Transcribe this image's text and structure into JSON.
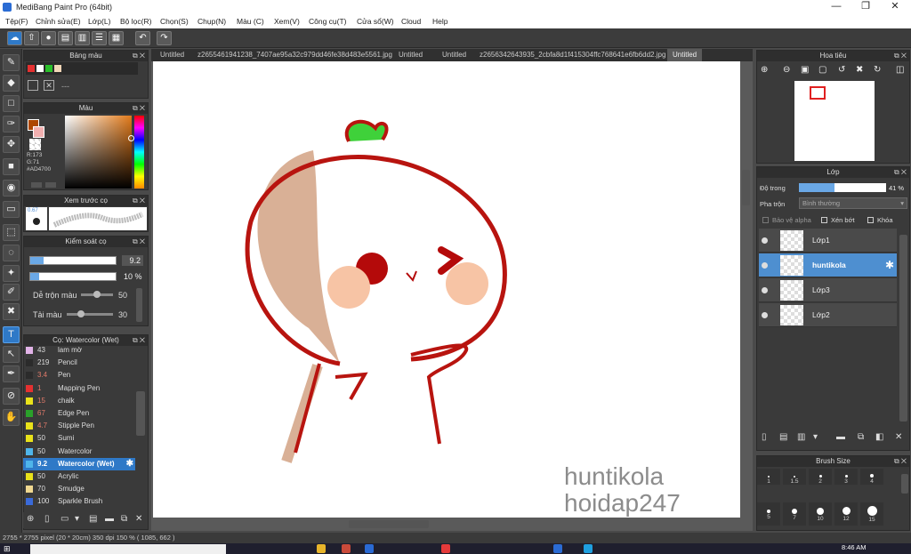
{
  "window": {
    "title": "MediBang Paint Pro (64bit)",
    "min": "—",
    "max": "❐",
    "close": "✕"
  },
  "menu": [
    "Tệp(F)",
    "Chỉnh sửa(E)",
    "Lớp(L)",
    "Bộ lọc(R)",
    "Chọn(S)",
    "Chụp(N)",
    "Màu (C)",
    "Xem(V)",
    "Công cụ(T)",
    "Cửa sổ(W)",
    "Cloud",
    "Help"
  ],
  "tabs": [
    "Untitled",
    "z2655461941238_7407ae95a32c979dd46fe38d483e5561.jpg",
    "Untitled",
    "Untitled",
    "z2656342643935_2cbfa8d1f415304ffc768641e6fb6dd2.jpg",
    "Untitled"
  ],
  "panels": {
    "palette": {
      "title": "Bảng màu",
      "sep": "---"
    },
    "color": {
      "title": "Màu",
      "r": "R:173",
      "g": "G:71",
      "hex": "#AD4700"
    },
    "preview": {
      "title": "Xem trước cọ",
      "size": "0.67"
    },
    "brushctl": {
      "title": "Kiểm soát cọ",
      "size_value": "9.2",
      "opacity_value": "10 %",
      "blend_label": "Dễ trộn màu",
      "blend_value": "50",
      "amount_label": "Tải màu",
      "amount_value": "30",
      "size_level": 0.16,
      "opacity_level": 0.1
    },
    "brushlist": {
      "title": "Cọ: Watercolor (Wet)",
      "items": [
        {
          "num": "43",
          "name": "lam mờ",
          "color": "#e2b3e8"
        },
        {
          "num": "219",
          "name": "Pencil",
          "color": "#2b2b2b"
        },
        {
          "num": "3.4",
          "name": "Pen",
          "color": "#2b2b2b"
        },
        {
          "num": "1",
          "name": "Mapping Pen",
          "color": "#e53030"
        },
        {
          "num": "15",
          "name": "chalk",
          "color": "#e9e21a"
        },
        {
          "num": "67",
          "name": "Edge Pen",
          "color": "#2aa12a"
        },
        {
          "num": "4.7",
          "name": "Stipple Pen",
          "color": "#e9e21a"
        },
        {
          "num": "50",
          "name": "Sumi",
          "color": "#e9e21a"
        },
        {
          "num": "50",
          "name": "Watercolor",
          "color": "#4fb5ea"
        },
        {
          "num": "9.2",
          "name": "Watercolor (Wet)",
          "color": "#4fb5ea"
        },
        {
          "num": "50",
          "name": "Acrylic",
          "color": "#e9e21a"
        },
        {
          "num": "70",
          "name": "Smudge",
          "color": "#f0d890"
        },
        {
          "num": "100",
          "name": "Sparkle Brush",
          "color": "#3a6ad9"
        }
      ]
    },
    "navigator": {
      "title": "Hoa tiêu"
    },
    "layers": {
      "title": "Lớp",
      "opacity_label": "Độ trong",
      "opacity_value": "41 %",
      "opacity_level": 0.41,
      "blend_label": "Pha trộn",
      "blend_value": "Bình thường",
      "protect_alpha": "Bảo vệ alpha",
      "clipping": "Xén bớt",
      "lock": "Khóa",
      "items": [
        "Lớp1",
        "huntikola",
        "Lớp3",
        "Lớp2"
      ]
    },
    "brushsize": {
      "title": "Brush Size",
      "sizes": [
        "1",
        "1.5",
        "2",
        "3",
        "4",
        "5",
        "7",
        "10",
        "12",
        "15"
      ]
    }
  },
  "canvas": {
    "watermark1": "huntikola",
    "watermark2": "hoidap247"
  },
  "status": "2755 * 2755 pixel  (20 * 20cm)  350 dpi  150 %  ( 1085, 662 )",
  "taskbar": {
    "time": "8:46 AM"
  }
}
